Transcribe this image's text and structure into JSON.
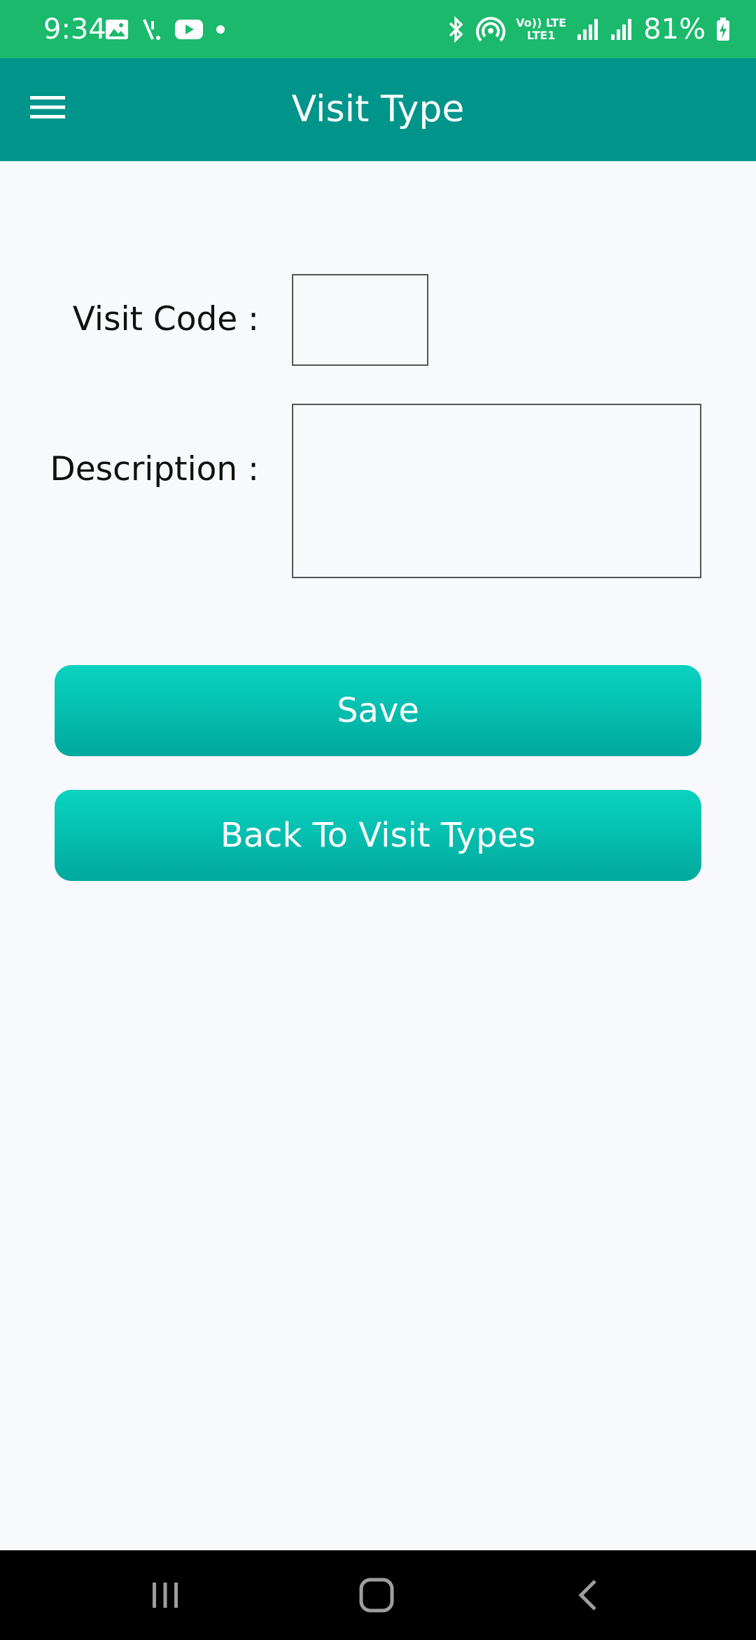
{
  "status_bar": {
    "time": "9:34",
    "network_label_top": "Vo)) LTE",
    "network_label_bottom": "LTE1",
    "battery": "81%",
    "background_color": "#1ab96c"
  },
  "app_bar": {
    "title": "Visit Type",
    "menu_icon": "hamburger-menu-icon",
    "background_color": "#00958a"
  },
  "form": {
    "visit_code_label": "Visit Code :",
    "visit_code_value": "",
    "description_label": "Description :",
    "description_value": ""
  },
  "buttons": {
    "save_label": "Save",
    "back_label": "Back To Visit Types",
    "accent_color": "#0ac2b2"
  },
  "nav_bar": {
    "recents_icon": "recents-icon",
    "home_icon": "home-icon",
    "back_icon": "back-icon"
  }
}
